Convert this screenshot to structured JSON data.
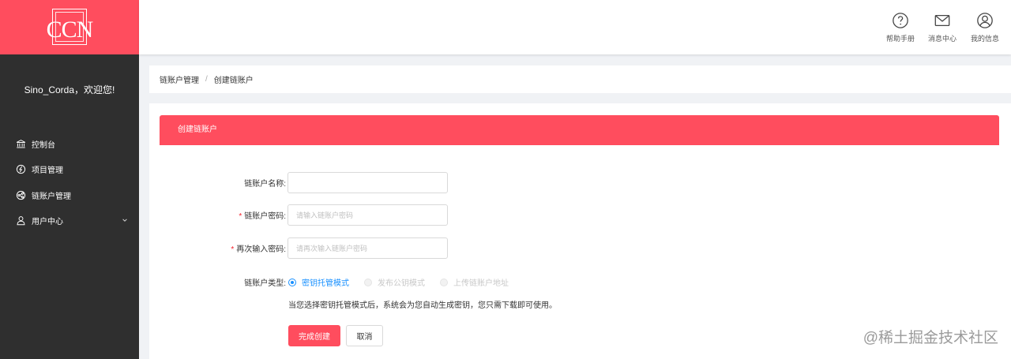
{
  "logo": {
    "text": "CCN"
  },
  "sidebar": {
    "welcome": "Sino_Corda，欢迎您!",
    "items": [
      {
        "label": "控制台",
        "icon": "bank-icon"
      },
      {
        "label": "项目管理",
        "icon": "project-icon"
      },
      {
        "label": "链账户管理",
        "icon": "share-nodes-icon"
      },
      {
        "label": "用户中心",
        "icon": "user-icon"
      }
    ]
  },
  "header": {
    "actions": [
      {
        "label": "帮助手册",
        "icon": "question-circle-icon"
      },
      {
        "label": "消息中心",
        "icon": "mail-icon"
      },
      {
        "label": "我的信息",
        "icon": "user-circle-icon"
      }
    ]
  },
  "breadcrumb": {
    "parent": "链账户管理",
    "separator": "/",
    "current": "创建链账户"
  },
  "form": {
    "card_title": "创建链账户",
    "fields": {
      "name": {
        "label": "链账户名称:",
        "value": "",
        "placeholder": ""
      },
      "password": {
        "label": "链账户密码:",
        "required": true,
        "placeholder": "请输入链账户密码"
      },
      "confirm": {
        "label": "再次输入密码:",
        "required": true,
        "placeholder": "请再次输入链账户密码"
      }
    },
    "type": {
      "label": "链账户类型:",
      "options": [
        {
          "label": "密钥托管模式",
          "state": "checked"
        },
        {
          "label": "发布公钥模式",
          "state": "disabled"
        },
        {
          "label": "上传链账户地址",
          "state": "disabled"
        }
      ],
      "hint": "当您选择密钥托管模式后，系统会为您自动生成密钥，您只需下载即可使用。"
    },
    "submit_label": "完成创建",
    "cancel_label": "取消"
  },
  "watermark": "@稀土掘金技术社区",
  "colors": {
    "brand": "#ff4d5e",
    "sidebar": "#2f2f2f",
    "link": "#1890ff"
  }
}
